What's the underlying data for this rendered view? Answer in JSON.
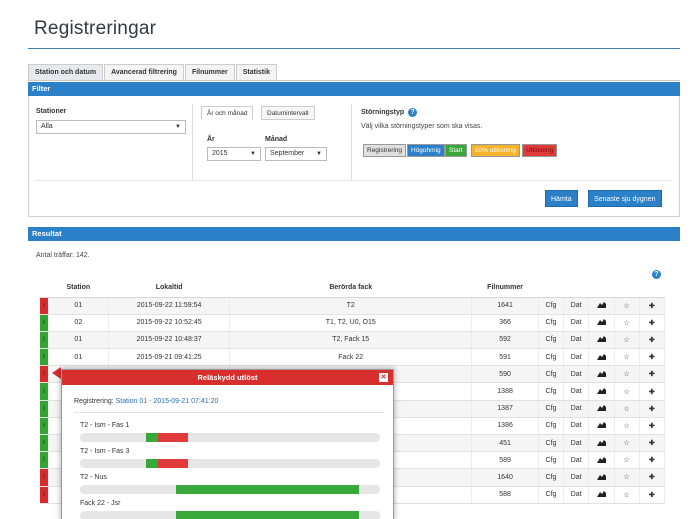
{
  "page": {
    "title": "Registreringar"
  },
  "tabs": [
    "Station och datum",
    "Avancerad filtrering",
    "Filnummer",
    "Statistik"
  ],
  "filter": {
    "header": "Filter",
    "stations_label": "Stationer",
    "stations_value": "Alla",
    "subtabs": [
      "År och månad",
      "Datumintervall"
    ],
    "year_label": "År",
    "year_value": "2015",
    "month_label": "Månad",
    "month_value": "September",
    "disturbance_label": "Störningstyp",
    "disturbance_help": "Välj vilka störningstyper som ska visas.",
    "types": [
      {
        "label": "Registrering",
        "color": "#e0e0e0"
      },
      {
        "label": "Högohmig",
        "color": "#2b80c8"
      },
      {
        "label": "Start",
        "color": "#39a83a"
      },
      {
        "label": "50% utlösning",
        "color": "#f3b32d"
      },
      {
        "label": "Utlösning",
        "color": "#e03a3a"
      }
    ],
    "fetch_label": "Hämta",
    "last_days_label": "Senaste sju dygnen"
  },
  "results": {
    "header": "Resultat",
    "count_text": "Antal träffar: 142.",
    "columns": [
      "Station",
      "Lokaltid",
      "Berörda fack",
      "Filnummer"
    ],
    "rows": [
      {
        "status": "red",
        "station": "01",
        "time": "2015-09-22 11:59:54",
        "fack": "T2",
        "file": "1641",
        "cfg": "Cfg",
        "dat": "Dat"
      },
      {
        "status": "green",
        "station": "02",
        "time": "2015-09-22 10:52:45",
        "fack": "T1, T2, U0, O15",
        "file": "366",
        "cfg": "Cfg",
        "dat": "Dat"
      },
      {
        "status": "green",
        "station": "01",
        "time": "2015-09-22 10:48:37",
        "fack": "T2, Fack 15",
        "file": "592",
        "cfg": "Cfg",
        "dat": "Dat"
      },
      {
        "status": "green",
        "station": "01",
        "time": "2015-09-21 09:41:25",
        "fack": "Fack 22",
        "file": "591",
        "cfg": "Cfg",
        "dat": "Dat"
      },
      {
        "status": "red",
        "station": "",
        "time": "",
        "fack": "",
        "file": "590",
        "cfg": "Cfg",
        "dat": "Dat"
      },
      {
        "status": "green",
        "station": "",
        "time": "",
        "fack": "",
        "file": "1388",
        "cfg": "Cfg",
        "dat": "Dat"
      },
      {
        "status": "green",
        "station": "",
        "time": "",
        "fack": "",
        "file": "1387",
        "cfg": "Cfg",
        "dat": "Dat"
      },
      {
        "status": "green",
        "station": "",
        "time": "",
        "fack": "",
        "file": "1386",
        "cfg": "Cfg",
        "dat": "Dat"
      },
      {
        "status": "green",
        "station": "",
        "time": "",
        "fack": "",
        "file": "451",
        "cfg": "Cfg",
        "dat": "Dat"
      },
      {
        "status": "green",
        "station": "",
        "time": "",
        "fack": "",
        "file": "589",
        "cfg": "Cfg",
        "dat": "Dat"
      },
      {
        "status": "red",
        "station": "",
        "time": "",
        "fack": "",
        "file": "1640",
        "cfg": "Cfg",
        "dat": "Dat"
      },
      {
        "status": "red",
        "station": "",
        "time": "",
        "fack": "",
        "file": "588",
        "cfg": "Cfg",
        "dat": "Dat"
      }
    ]
  },
  "popup": {
    "title": "Reläskydd utlöst",
    "reg_prefix": "Registrering:",
    "reg_link": "Station 01 - 2015-09-21 07:41:20",
    "rows": [
      {
        "label": "T2 - Ism - Fas 1",
        "segments": [
          {
            "color": "#39a83a",
            "start": 0.22,
            "end": 0.26
          },
          {
            "color": "#e03a3a",
            "start": 0.26,
            "end": 0.36
          }
        ]
      },
      {
        "label": "T2 - Ism - Fas 3",
        "segments": [
          {
            "color": "#39a83a",
            "start": 0.22,
            "end": 0.26
          },
          {
            "color": "#e03a3a",
            "start": 0.26,
            "end": 0.36
          }
        ]
      },
      {
        "label": "T2 - Nus",
        "segments": [
          {
            "color": "#39a83a",
            "start": 0.32,
            "end": 0.93
          }
        ]
      },
      {
        "label": "Fack 22 - Jsr",
        "segments": [
          {
            "color": "#39a83a",
            "start": 0.32,
            "end": 0.93
          }
        ]
      }
    ]
  },
  "icons": {
    "status": "i-icon",
    "chart": "chart-icon",
    "star": "star-icon",
    "add": "plus-icon",
    "help": "help-icon",
    "close": "close-icon"
  }
}
